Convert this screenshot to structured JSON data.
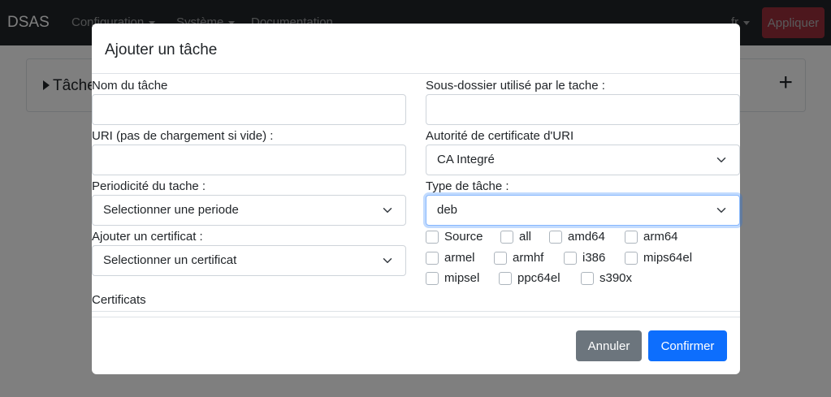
{
  "navbar": {
    "brand": "DSAS",
    "items": [
      "Configuration",
      "Système",
      "Documentation"
    ],
    "lang": "fr",
    "apply_label": "Appliquer"
  },
  "page": {
    "card_title": "Tâches",
    "add_symbol": "+"
  },
  "modal": {
    "title": "Ajouter un tâche",
    "fields": {
      "name_label": "Nom du tâche",
      "name_value": "",
      "subfolder_label": "Sous-dossier utilisé par le tache :",
      "subfolder_value": "",
      "uri_label": "URI (pas de chargement si vide) :",
      "uri_value": "",
      "uri_ca_label": "Autorité de certificate d'URI",
      "uri_ca_value": "CA Integré",
      "period_label": "Periodicité du tache :",
      "period_value": "Selectionner une periode",
      "type_label": "Type de tâche :",
      "type_value": "deb",
      "cert_label": "Ajouter un certificat :",
      "cert_value": "Selectionner un certificat",
      "certs_heading": "Certificats"
    },
    "architectures": [
      "Source",
      "all",
      "amd64",
      "arm64",
      "armel",
      "armhf",
      "i386",
      "mips64el",
      "mipsel",
      "ppc64el",
      "s390x"
    ],
    "cancel_label": "Annuler",
    "confirm_label": "Confirmer"
  },
  "colors": {
    "primary": "#0d6efd",
    "secondary": "#6c757d",
    "danger": "#dc3545",
    "navbar": "#212529"
  }
}
